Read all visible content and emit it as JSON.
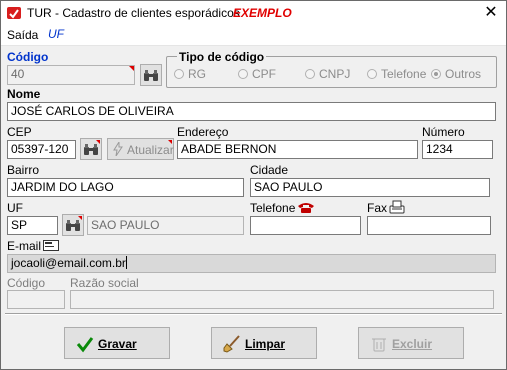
{
  "window": {
    "title": "TUR - Cadastro de clientes esporádicos",
    "example_label": "EXEMPLO",
    "close_glyph": "✕"
  },
  "menu": {
    "saida": "Saída",
    "uf": "UF"
  },
  "codigo": {
    "label": "Código",
    "value": "40"
  },
  "tipo_codigo": {
    "label": "Tipo de código",
    "options": [
      "RG",
      "CPF",
      "CNPJ",
      "Telefone",
      "Outros"
    ],
    "selected": "Outros"
  },
  "nome": {
    "label": "Nome",
    "value": "JOSÉ CARLOS DE OLIVEIRA"
  },
  "cep": {
    "label": "CEP",
    "value": "05397-120"
  },
  "atualizar": {
    "label": "Atualizar"
  },
  "endereco": {
    "label": "Endereço",
    "value": "ABADE BERNON"
  },
  "numero": {
    "label": "Número",
    "value": "1234"
  },
  "bairro": {
    "label": "Bairro",
    "value": "JARDIM DO LAGO"
  },
  "cidade": {
    "label": "Cidade",
    "value": "SAO PAULO"
  },
  "uf_field": {
    "label": "UF",
    "value": "SP",
    "state_name": "SAO PAULO"
  },
  "telefone": {
    "label": "Telefone",
    "value": ""
  },
  "fax": {
    "label": "Fax",
    "value": ""
  },
  "email": {
    "label": "E-mail",
    "value": "jocaoli@email.com.br"
  },
  "codigo2": {
    "label": "Código",
    "value": ""
  },
  "razao_social": {
    "label": "Razão social",
    "value": ""
  },
  "buttons": {
    "gravar": "Gravar",
    "limpar": "Limpar",
    "excluir": "Excluir"
  },
  "colors": {
    "accent_red": "#e00000",
    "menu_blue": "#0033cc"
  }
}
